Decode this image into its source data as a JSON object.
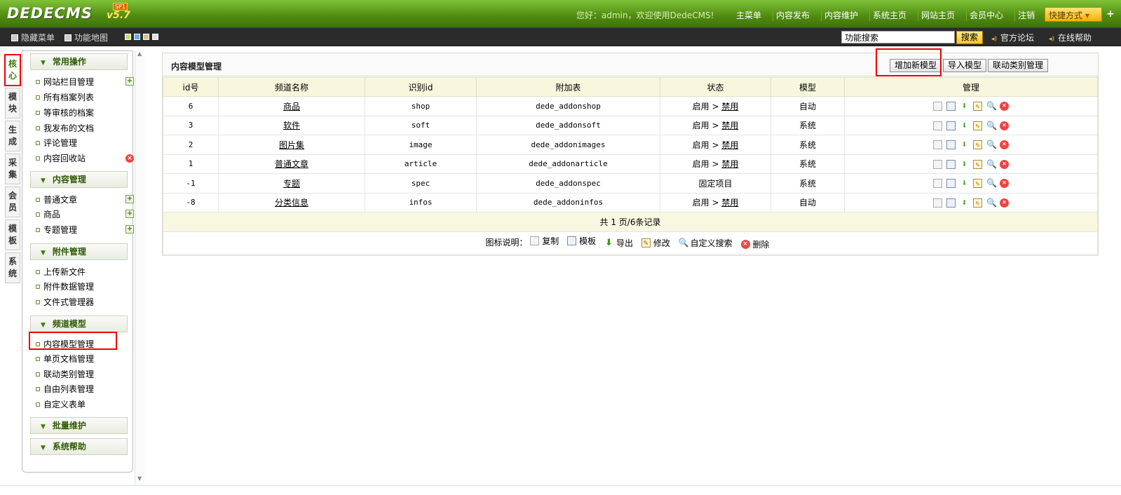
{
  "app": {
    "logo_text": "DEDECMS",
    "version": "v5.7",
    "sp_badge": "SP1",
    "welcome": "您好：admin，欢迎使用DedeCMS!",
    "top_nav": [
      "主菜单",
      "内容发布",
      "内容维护",
      "系统主页",
      "网站主页",
      "会员中心",
      "注销"
    ],
    "quick_label": "快捷方式",
    "quick_plus": "+"
  },
  "toolbar": {
    "hide_menu": "隐藏菜单",
    "site_map": "功能地图",
    "search_value": "功能搜索",
    "search_button": "搜索",
    "forum_link": "官方论坛",
    "help_link": "在线帮助",
    "skin_colors": [
      "#c8e070",
      "#5fb0e0",
      "#d8c098",
      "#e0e0e0"
    ]
  },
  "vertical_tabs": [
    "核心",
    "模块",
    "生成",
    "采集",
    "会员",
    "模板",
    "系统"
  ],
  "sidebar": {
    "groups": [
      {
        "title": "常用操作",
        "items": [
          "网站栏目管理",
          "所有档案列表",
          "等审核的档案",
          "我发布的文档",
          "评论管理",
          "内容回收站"
        ]
      },
      {
        "title": "内容管理",
        "items": [
          "普通文章",
          "商品",
          "专题管理"
        ]
      },
      {
        "title": "附件管理",
        "items": [
          "上传新文件",
          "附件数据管理",
          "文件式管理器"
        ]
      },
      {
        "title": "频道模型",
        "items": [
          "内容模型管理",
          "单页文档管理",
          "联动类别管理",
          "自由列表管理",
          "自定义表单"
        ]
      },
      {
        "title": "批量维护",
        "items": []
      },
      {
        "title": "系统帮助",
        "items": []
      }
    ]
  },
  "main": {
    "title": "内容模型管理",
    "buttons": [
      "增加新模型",
      "导入模型",
      "联动类别管理"
    ],
    "columns": [
      "id号",
      "频道名称",
      "识别id",
      "附加表",
      "状态",
      "模型",
      "管理"
    ],
    "rows": [
      {
        "id": "6",
        "name": "商品",
        "nid": "shop",
        "table": "dede_addonshop",
        "status": "启用",
        "status_link": "禁用",
        "model": "自动"
      },
      {
        "id": "3",
        "name": "软件",
        "nid": "soft",
        "table": "dede_addonsoft",
        "status": "启用",
        "status_link": "禁用",
        "model": "系统"
      },
      {
        "id": "2",
        "name": "图片集",
        "nid": "image",
        "table": "dede_addonimages",
        "status": "启用",
        "status_link": "禁用",
        "model": "系统"
      },
      {
        "id": "1",
        "name": "普通文章",
        "nid": "article",
        "table": "dede_addonarticle",
        "status": "启用",
        "status_link": "禁用",
        "model": "系统"
      },
      {
        "id": "-1",
        "name": "专题",
        "nid": "spec",
        "table": "dede_addonspec",
        "status": "固定项目",
        "status_link": "",
        "model": "系统"
      },
      {
        "id": "-8",
        "name": "分类信息",
        "nid": "infos",
        "table": "dede_addoninfos",
        "status": "启用",
        "status_link": "禁用",
        "model": "自动"
      }
    ],
    "pager": "共 1 页/6条记录",
    "legend_label": "图标说明：",
    "legend": [
      "复制",
      "模板",
      "导出",
      "修改",
      "自定义搜索",
      "删除"
    ]
  }
}
